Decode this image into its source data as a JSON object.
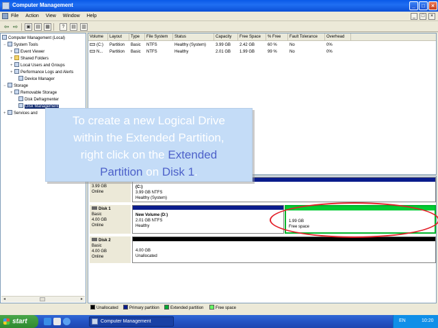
{
  "window": {
    "title": "Computer Management",
    "controls": {
      "minimize": "_",
      "maximize": "□",
      "close": "×"
    }
  },
  "menu": {
    "items": [
      "File",
      "Action",
      "View",
      "Window",
      "Help"
    ],
    "child_controls": {
      "minimize": "_",
      "restore": "□",
      "close": "×"
    }
  },
  "toolbar": {
    "buttons": [
      {
        "name": "back",
        "glyph": "⇦"
      },
      {
        "name": "forward",
        "glyph": "⇨"
      },
      {
        "name": "up",
        "glyph": "▣"
      },
      {
        "name": "show-hide-tree",
        "glyph": "▤"
      },
      {
        "name": "export",
        "glyph": "▦"
      },
      {
        "name": "help",
        "glyph": "?"
      },
      {
        "name": "properties",
        "glyph": "▤"
      },
      {
        "name": "view",
        "glyph": "▥"
      }
    ]
  },
  "tree": {
    "items": [
      {
        "label": "Computer Management (Local)",
        "expander": ""
      },
      {
        "label": "System Tools",
        "expander": "−"
      },
      {
        "label": "Event Viewer",
        "expander": "+"
      },
      {
        "label": "Shared Folders",
        "expander": "+"
      },
      {
        "label": "Local Users and Groups",
        "expander": "+"
      },
      {
        "label": "Performance Logs and Alerts",
        "expander": "+"
      },
      {
        "label": "Device Manager",
        "expander": ""
      },
      {
        "label": "Storage",
        "expander": "−"
      },
      {
        "label": "Removable Storage",
        "expander": "+"
      },
      {
        "label": "Disk Defragmenter",
        "expander": ""
      },
      {
        "label": "Disk Management",
        "expander": ""
      },
      {
        "label": "Services and",
        "expander": "+"
      }
    ],
    "scroll": {
      "left": "◂",
      "right": "▸"
    }
  },
  "volume_list": {
    "columns": [
      "Volume",
      "Layout",
      "Type",
      "File System",
      "Status",
      "Capacity",
      "Free Space",
      "% Free",
      "Fault Tolerance",
      "Overhead"
    ],
    "rows": [
      [
        "(C:)",
        "Partition",
        "Basic",
        "NTFS",
        "Healthy (System)",
        "3.99 GB",
        "2.42 GB",
        "60 %",
        "No",
        "0%"
      ],
      [
        "N...",
        "Partition",
        "Basic",
        "NTFS",
        "Healthy",
        "2.01 GB",
        "1.99 GB",
        "99 %",
        "No",
        "0%"
      ]
    ]
  },
  "disks": [
    {
      "name": "",
      "type": "Basic",
      "size": "3.99 GB",
      "status": "Online",
      "partitions": [
        {
          "name": "(C:)",
          "line1": "3.99 GB NTFS",
          "line2": "Healthy (System)",
          "bar_color": "#0a1c8c"
        }
      ]
    },
    {
      "name": "Disk 1",
      "type": "Basic",
      "size": "4.00 GB",
      "status": "Online",
      "partitions": [
        {
          "name": "New Volume  (D:)",
          "line1": "2.01 GB NTFS",
          "line2": "Healthy",
          "bar_color": "#0a1c8c"
        },
        {
          "name": "",
          "line1": "1.99 GB",
          "line2": "Free space",
          "bar_color": "#00cc33"
        }
      ]
    },
    {
      "name": "Disk 2",
      "type": "Basic",
      "size": "4.00 GB",
      "status": "Online",
      "partitions": [
        {
          "name": "",
          "line1": "4.00 GB",
          "line2": "Unallocated",
          "bar_color": "#000000"
        }
      ]
    }
  ],
  "legend": [
    {
      "label": "Unallocated",
      "color": "#000000"
    },
    {
      "label": "Primary partition",
      "color": "#0a1c8c"
    },
    {
      "label": "Extended partition",
      "color": "#00aa33"
    },
    {
      "label": "Free space",
      "color": "#66ff66"
    }
  ],
  "callout": {
    "line1": "To create a new Logical Drive",
    "line2": "within the Extended Partition,",
    "line3_pre": "right click on the ",
    "line3_hl": "Extended",
    "line4_hl1": "Partition",
    "line4_mid": " on ",
    "line4_hl2": "Disk 1",
    "line4_end": "."
  },
  "taskbar": {
    "start_label": "start",
    "task_label": "Computer Management",
    "language": "EN",
    "clock": "10:20"
  }
}
